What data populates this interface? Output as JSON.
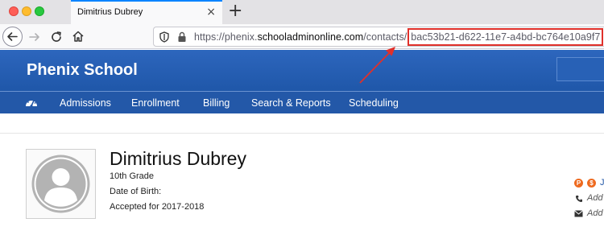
{
  "browser": {
    "tab_title": "Dimitrius Dubrey",
    "tab_close": "×",
    "new_tab": "+",
    "url_prefix": "https://phenix.",
    "url_host": "schooladminonline.com",
    "url_path": "/contacts/",
    "url_id": "bac53b21-d622-11e7-a4bd-bc764e10a9f7"
  },
  "school": {
    "name": "Phenix School"
  },
  "menu": {
    "items": [
      "Admissions",
      "Enrollment",
      "Billing",
      "Search & Reports",
      "Scheduling"
    ]
  },
  "student": {
    "name": "Dimitrius Dubrey",
    "grade": "10th Grade",
    "dob_label": "Date of Birth:",
    "status": "Accepted for 2017-2018"
  },
  "side": {
    "coin_p": "P",
    "coin_s": "$",
    "partial_link": "J",
    "add_phone": "Add",
    "add_email": "Add"
  },
  "colors": {
    "accent_blue": "#2358a8",
    "highlight_red": "#e0302a",
    "coin_orange": "#ee6a1f"
  }
}
